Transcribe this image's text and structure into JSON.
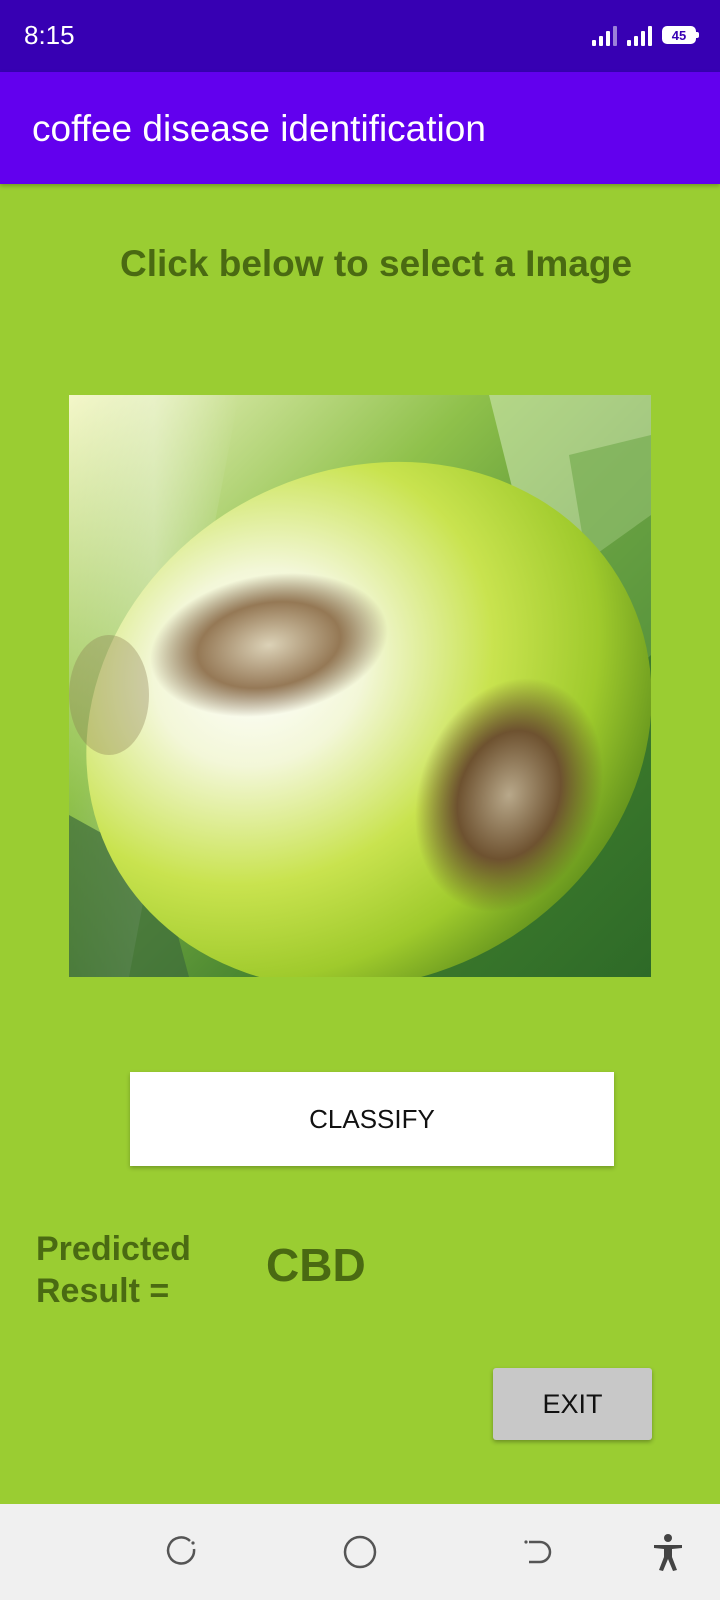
{
  "status_bar": {
    "time": "8:15",
    "battery_level": "45",
    "icons": [
      "signal-icon",
      "signal-icon",
      "battery-icon"
    ]
  },
  "app_bar": {
    "title": "coffee disease identification",
    "background_color": "#6200ee"
  },
  "main": {
    "prompt": "Click below to select a Image",
    "image": {
      "subject": "coffee berry with disease lesions"
    },
    "classify_label": "CLASSIFY",
    "result_label": "Predicted Result =",
    "result_value": "CBD",
    "exit_label": "EXIT",
    "background_color": "#9acd32",
    "text_color": "#4a6a12"
  },
  "nav_bar": {
    "icons": [
      "recents-icon",
      "home-icon",
      "back-icon",
      "accessibility-icon"
    ]
  }
}
